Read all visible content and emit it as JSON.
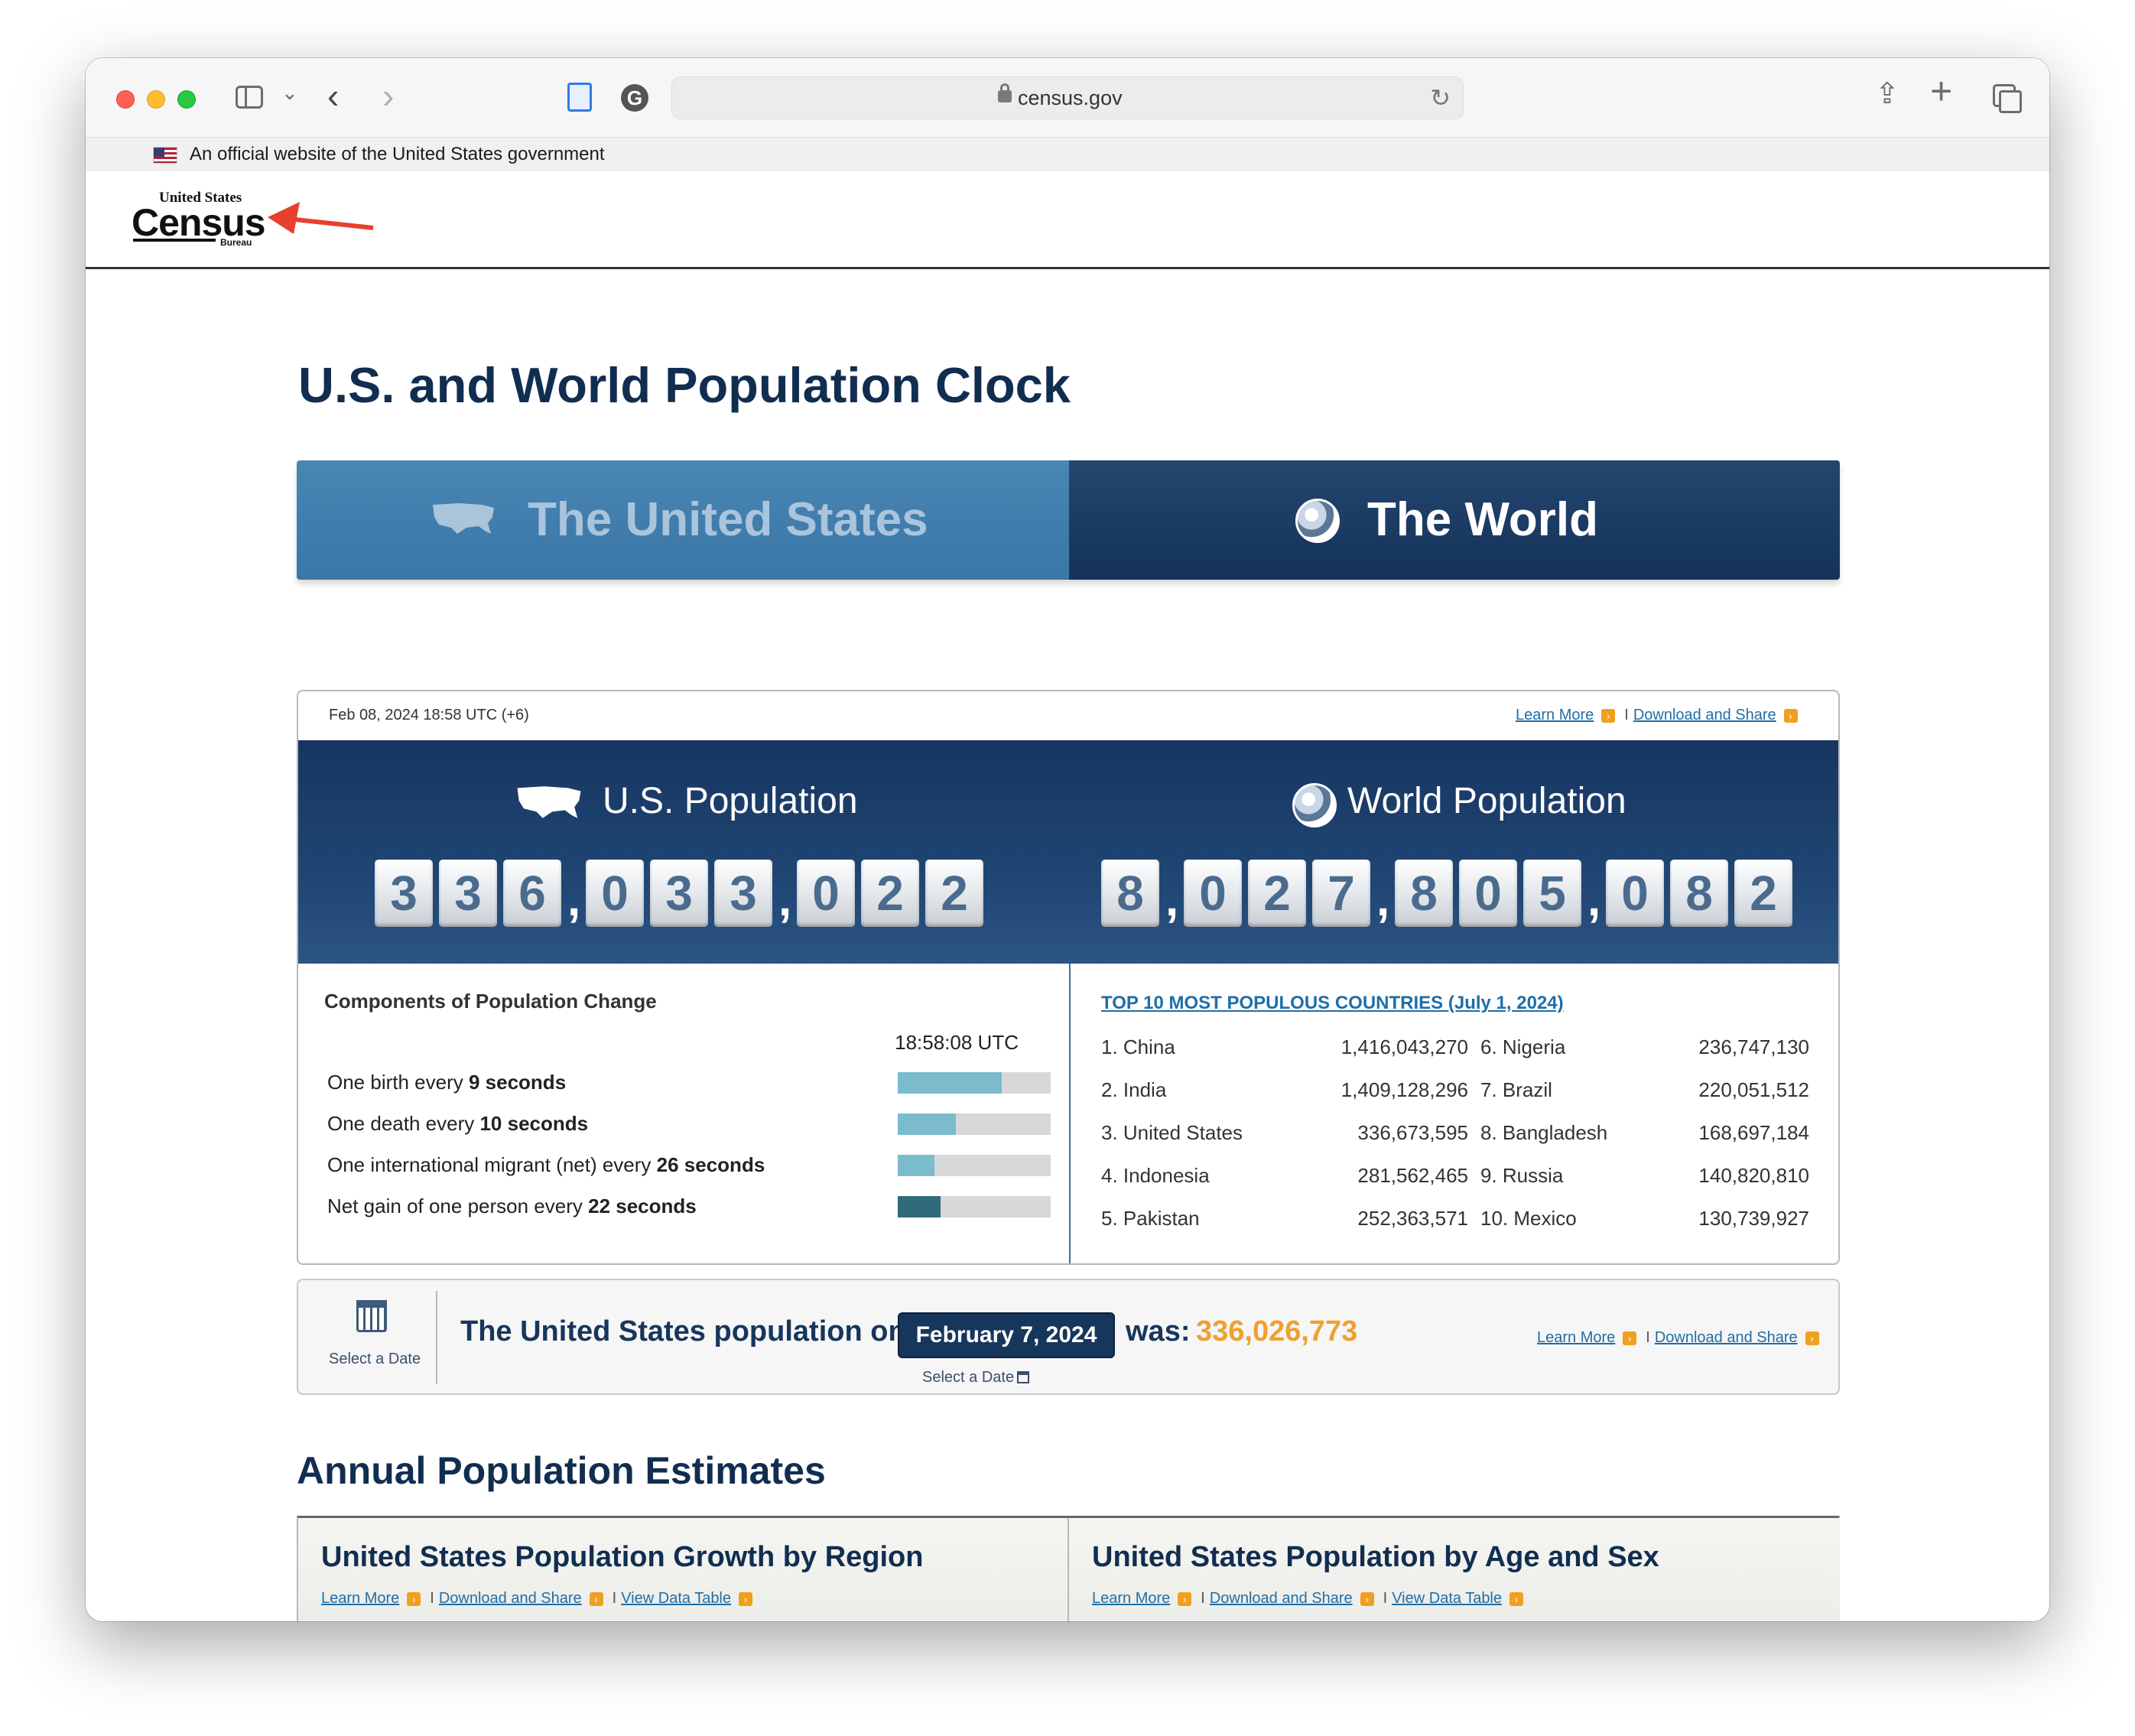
{
  "browser": {
    "url": "census.gov"
  },
  "gov_banner": {
    "text": "An official website of the United States government"
  },
  "logo": {
    "top": "United States",
    "registered": "®",
    "main": "Census",
    "bottom": "Bureau"
  },
  "page": {
    "title": "U.S. and World Population Clock"
  },
  "tabs": [
    {
      "label": "The United States",
      "active": false
    },
    {
      "label": "The World",
      "active": true
    }
  ],
  "clock": {
    "datetime": "Feb 08, 2024 18:58 UTC (+6)",
    "learn_more": "Learn More",
    "download_share": "Download and Share",
    "separator": "I",
    "us_title": "U.S. Population",
    "world_title": "World Population",
    "us_population": "336,033,022",
    "world_population": "8,027,805,082"
  },
  "components": {
    "title": "Components of Population Change",
    "time": "18:58:08 UTC",
    "rows": [
      {
        "prefix": "One birth every ",
        "bold": "9 seconds",
        "fill_percent": 68,
        "dark": false
      },
      {
        "prefix": "One death every ",
        "bold": "10 seconds",
        "fill_percent": 38,
        "dark": false
      },
      {
        "prefix": "One international migrant (net) every ",
        "bold": "26 seconds",
        "fill_percent": 24,
        "dark": false
      },
      {
        "prefix": "Net gain of one person every ",
        "bold": "22 seconds",
        "fill_percent": 28,
        "dark": true
      }
    ]
  },
  "top10": {
    "title": "TOP 10 MOST POPULOUS COUNTRIES (July 1, 2024)",
    "left": [
      {
        "name": "1. China",
        "pop": "1,416,043,270"
      },
      {
        "name": "2. India",
        "pop": "1,409,128,296"
      },
      {
        "name": "3. United States",
        "pop": "336,673,595"
      },
      {
        "name": "4. Indonesia",
        "pop": "281,562,465"
      },
      {
        "name": "5. Pakistan",
        "pop": "252,363,571"
      }
    ],
    "right": [
      {
        "name": "6. Nigeria",
        "pop": "236,747,130"
      },
      {
        "name": "7. Brazil",
        "pop": "220,051,512"
      },
      {
        "name": "8. Bangladesh",
        "pop": "168,697,184"
      },
      {
        "name": "9. Russia",
        "pop": "140,820,810"
      },
      {
        "name": "10. Mexico",
        "pop": "130,739,927"
      }
    ]
  },
  "history": {
    "select_label": "Select a Date",
    "text": "The United States population on",
    "date": "February 7, 2024",
    "was": "was:",
    "value": "336,026,773",
    "select_under": "Select a Date",
    "learn_more": "Learn More",
    "download_share": "Download and Share",
    "separator": "I"
  },
  "annual": {
    "title": "Annual Population Estimates",
    "cards": [
      {
        "title": "United States Population Growth by Region",
        "learn_more": "Learn More",
        "download_share": "Download and Share",
        "view_table": "View Data Table",
        "separator": "I",
        "axis_top": "400"
      },
      {
        "title": "United States Population by Age and Sex",
        "learn_more": "Learn More",
        "download_share": "Download and Share",
        "view_table": "View Data Table",
        "separator": "I"
      }
    ]
  },
  "colors": {
    "navy": "#112e51",
    "accent_orange": "#f0a030",
    "link_blue": "#1f6ea8"
  }
}
